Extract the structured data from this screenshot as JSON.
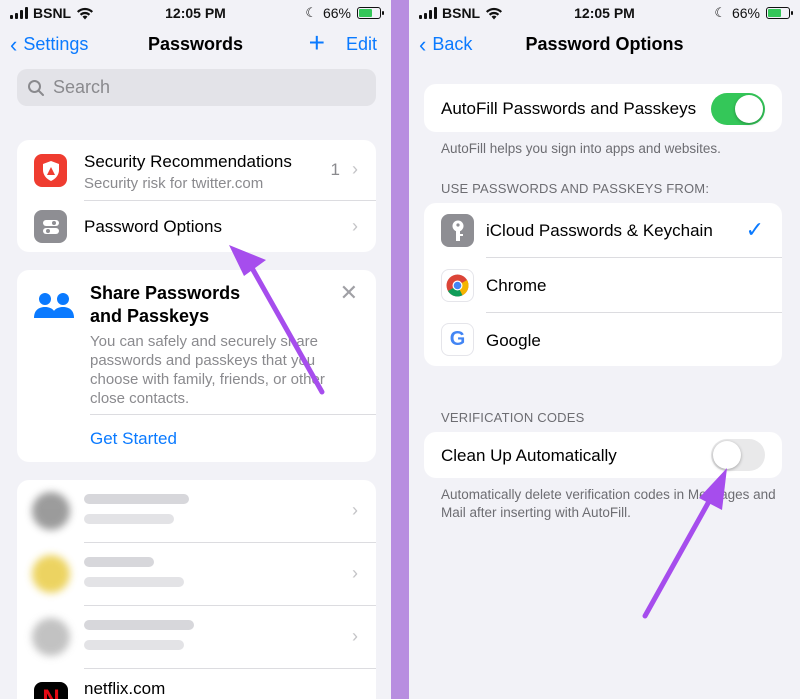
{
  "left": {
    "status": {
      "carrier": "BSNL",
      "time": "12:05 PM",
      "battery": "66%"
    },
    "nav": {
      "back_label": "Settings",
      "title": "Passwords",
      "add_label": "+",
      "edit_label": "Edit"
    },
    "search": {
      "placeholder": "Search"
    },
    "security": {
      "title": "Security Recommendations",
      "subtitle": "Security risk for twitter.com",
      "count": "1"
    },
    "options": {
      "title": "Password Options"
    },
    "share": {
      "title_line1": "Share Passwords",
      "title_line2": "and Passkeys",
      "body": "You can safely and securely share passwords and passkeys that you choose with family, friends, or other close contacts.",
      "action": "Get Started"
    },
    "accounts": [
      {
        "label": "",
        "icon_color": "#5a5a5a"
      },
      {
        "label": "",
        "icon_color": "#e8c93a"
      },
      {
        "label": "",
        "icon_color": "#9a9a9a"
      },
      {
        "label": "netflix.com",
        "icon_color": "#000000"
      }
    ]
  },
  "right": {
    "status": {
      "carrier": "BSNL",
      "time": "12:05 PM",
      "battery": "66%"
    },
    "nav": {
      "back_label": "Back",
      "title": "Password Options"
    },
    "autofill": {
      "label": "AutoFill Passwords and Passkeys",
      "enabled": true,
      "footnote": "AutoFill helps you sign into apps and websites."
    },
    "sources": {
      "header": "USE PASSWORDS AND PASSKEYS FROM:",
      "items": [
        {
          "label": "iCloud Passwords & Keychain",
          "checked": true,
          "icon": "key-icon"
        },
        {
          "label": "Chrome",
          "checked": false,
          "icon": "chrome-icon"
        },
        {
          "label": "Google",
          "checked": false,
          "icon": "google-icon"
        }
      ]
    },
    "verification": {
      "header": "VERIFICATION CODES",
      "label": "Clean Up Automatically",
      "enabled": false,
      "footnote": "Automatically delete verification codes in Messages and Mail after inserting with AutoFill."
    }
  },
  "colors": {
    "accent": "#0a7aff",
    "toggle_on": "#34c759",
    "arrow": "#a64ded",
    "security_red": "#ef3c30"
  }
}
